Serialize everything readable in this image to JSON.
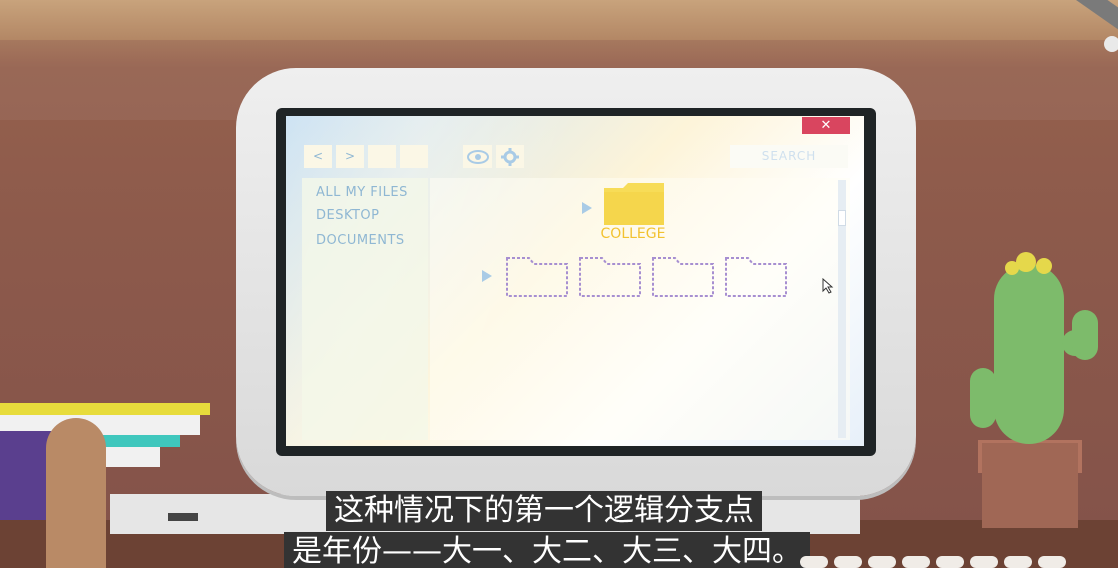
{
  "window": {
    "close_label": "✕",
    "nav_back": "<",
    "nav_forward": ">",
    "view_icon": "eye-icon",
    "settings_icon": "gear-icon",
    "search_placeholder": "SEARCH"
  },
  "sidebar": {
    "items": [
      {
        "label": "ALL MY FILES"
      },
      {
        "label": "DESKTOP"
      },
      {
        "label": "DOCUMENTS"
      }
    ]
  },
  "files": {
    "parent_folder": {
      "label": "COLLEGE",
      "color": "#f7dc57"
    },
    "child_folders": [
      {
        "label": ""
      },
      {
        "label": ""
      },
      {
        "label": ""
      },
      {
        "label": ""
      }
    ]
  },
  "subtitle": {
    "line1": "这种情况下的第一个逻辑分支点",
    "line2": "是年份——大一、大二、大三、大四。"
  },
  "player_controls": [
    "",
    "",
    "",
    "",
    "",
    "",
    "",
    "",
    "",
    ""
  ],
  "colors": {
    "accent": "#d9455f",
    "folder": "#f7dc57",
    "folder_outline": "#a78fd1",
    "text_blue": "#8fb7d3"
  }
}
